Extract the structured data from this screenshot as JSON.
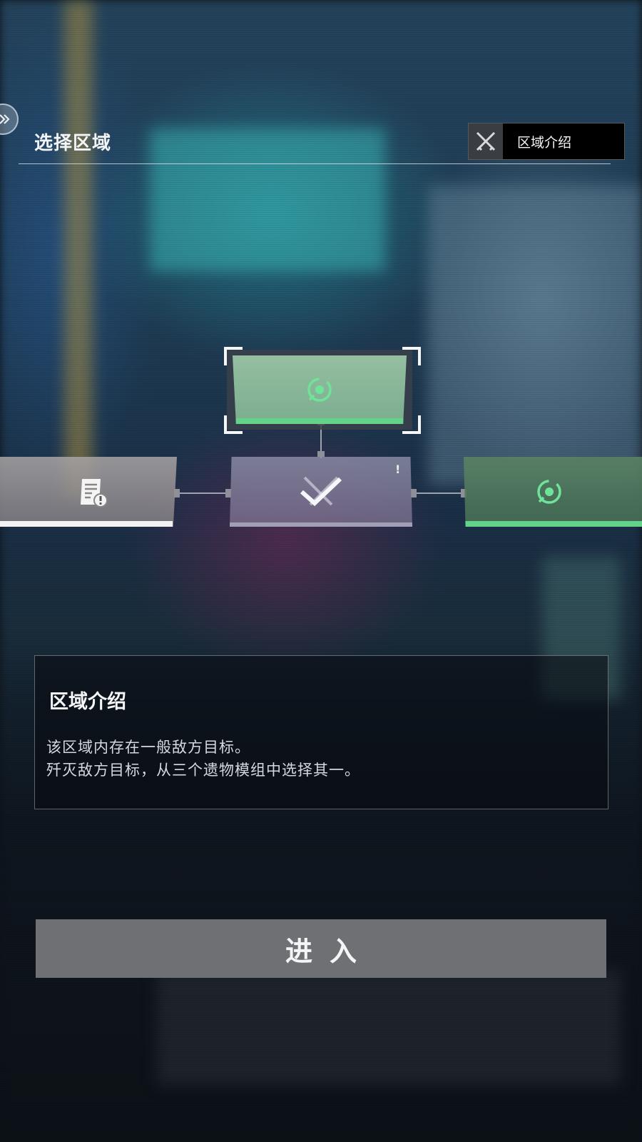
{
  "header": {
    "title": "选择区域",
    "intro_button_label": "区域介绍"
  },
  "map": {
    "nodes": [
      {
        "id": "top",
        "type": "target",
        "state": "selected",
        "accent": "#63d38a"
      },
      {
        "id": "left",
        "type": "document-alert",
        "state": "cleared",
        "accent": "#f2f2f2"
      },
      {
        "id": "middle",
        "type": "combat",
        "state": "completed",
        "alert": "!"
      },
      {
        "id": "right",
        "type": "target",
        "state": "available",
        "accent": "#63d38a"
      }
    ]
  },
  "info": {
    "title": "区域介绍",
    "lines": [
      "该区域内存在一般敌方目标。",
      "歼灭敌方目标，从三个遗物模组中选择其一。"
    ]
  },
  "actions": {
    "enter_label": "进入"
  },
  "colors": {
    "accent_green": "#63d38a",
    "button_gray": "#6e7073",
    "panel_black": "#000000"
  }
}
